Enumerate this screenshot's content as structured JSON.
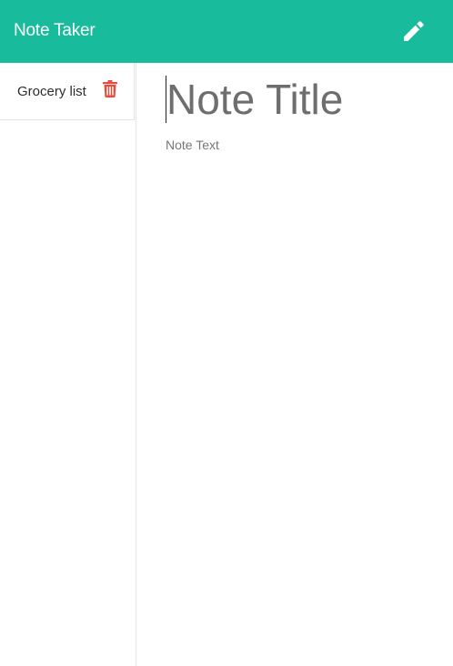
{
  "app": {
    "brand": "Note Taker"
  },
  "toolbar": {
    "new_note_icon": "pencil-icon",
    "icon_color": "#ffffff"
  },
  "theme": {
    "navbar_color": "#18bc9c",
    "delete_color": "#e74c3c"
  },
  "sidebar": {
    "notes": [
      {
        "title": "Grocery list",
        "delete_icon": "trash-icon"
      }
    ]
  },
  "editor": {
    "title_placeholder": "Note Title",
    "title_value": "",
    "text_placeholder": "Note Text",
    "text_value": ""
  }
}
